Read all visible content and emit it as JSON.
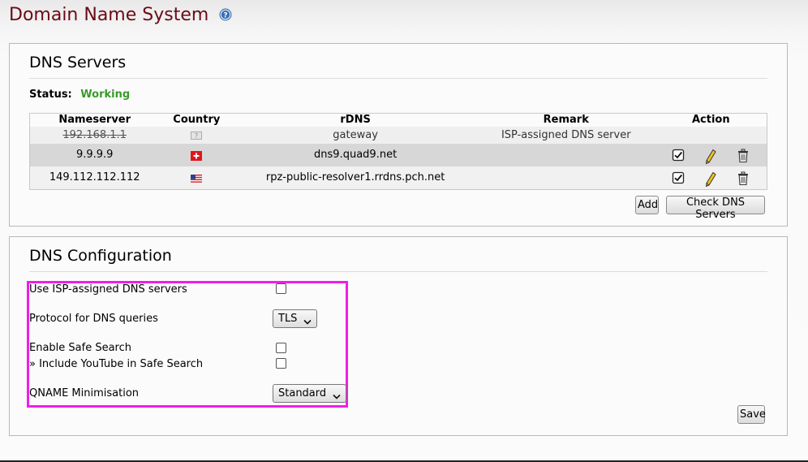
{
  "page": {
    "title": "Domain Name System"
  },
  "servers": {
    "title": "DNS Servers",
    "status_label": "Status:",
    "status_value": "Working",
    "columns": [
      "Nameserver",
      "Country",
      "rDNS",
      "Remark",
      "Action"
    ],
    "isp_row": {
      "nameserver": "192.168.1.1",
      "rdns": "gateway",
      "remark": "ISP-assigned DNS server"
    },
    "rows": [
      {
        "nameserver": "9.9.9.9",
        "rdns": "dns9.quad9.net",
        "remark": "",
        "country_flag": "switzerland-flag"
      },
      {
        "nameserver": "149.112.112.112",
        "rdns": "rpz-public-resolver1.rrdns.pch.net",
        "remark": "",
        "country_flag": "united-states-flag"
      }
    ],
    "add_label": "Add",
    "check_label": "Check DNS Servers"
  },
  "config": {
    "title": "DNS Configuration",
    "use_isp_label": "Use ISP-assigned DNS servers",
    "protocol_label": "Protocol for DNS queries",
    "protocol_value": "TLS",
    "safe_search_label": "Enable Safe Search",
    "youtube_label": "» Include YouTube in Safe Search",
    "qname_label": "QNAME Minimisation",
    "qname_value": "Standard",
    "save_label": "Save"
  },
  "colors": {
    "title": "#6b0a16",
    "status_ok": "#3a9a2a",
    "highlight": "#f01ee8"
  }
}
